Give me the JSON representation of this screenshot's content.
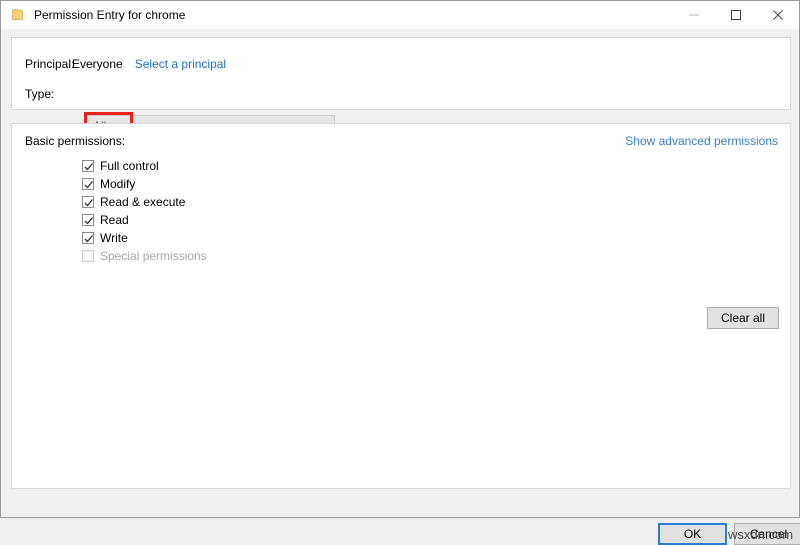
{
  "window": {
    "title": "Permission Entry for chrome",
    "icon": "folder-icon",
    "controls": {
      "minimize": "Minimize",
      "maximize": "Maximize",
      "close": "Close"
    }
  },
  "principal": {
    "label": "Principal:",
    "value": "Everyone",
    "select_link": "Select a principal"
  },
  "type": {
    "label": "Type:",
    "value": "Allow",
    "highlighted": true,
    "highlight_color": "#e8201c"
  },
  "permissions": {
    "section_label": "Basic permissions:",
    "advanced_link": "Show advanced permissions",
    "advanced_link_color": "#3a7ebc",
    "items": [
      {
        "label": "Full control",
        "checked": true,
        "enabled": true
      },
      {
        "label": "Modify",
        "checked": true,
        "enabled": true
      },
      {
        "label": "Read & execute",
        "checked": true,
        "enabled": true
      },
      {
        "label": "Read",
        "checked": true,
        "enabled": true
      },
      {
        "label": "Write",
        "checked": true,
        "enabled": true
      },
      {
        "label": "Special permissions",
        "checked": false,
        "enabled": false
      }
    ],
    "clear_all_label": "Clear all"
  },
  "footer": {
    "ok_label": "OK",
    "cancel_label": "Cancel",
    "focus_color": "#2a7fd4"
  },
  "watermark": {
    "text": "wsxdn.com"
  }
}
